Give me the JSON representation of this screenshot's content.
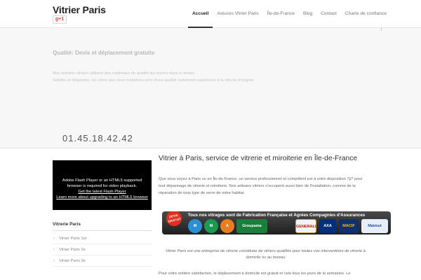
{
  "header": {
    "site_title": "Vitrier Paris",
    "gplus_label": "g+1",
    "nav": [
      "Accueil",
      "Astuces Vitrier Paris",
      "Île-de-France",
      "Blog",
      "Contact",
      "Charte de confiance"
    ]
  },
  "hero": {
    "title": "Qualité: Devis et déplacement gratuits",
    "line1": "Nos artisans vitriers utilisent des matériaux de qualité qui durent dans le temps.",
    "line2": "Solides et élégantes, les vitres que nous installons sont d'une qualité nettement supérieure à la vitrerie d'origine.",
    "phone": "01.45.18.42.42"
  },
  "sidebar": {
    "flash_line1": "Adobe Flash Player or an HTML5 supported",
    "flash_line2": "browser is required for video playback.",
    "flash_link1": "Get the latest Flash Player",
    "flash_link2": "Learn more about upgrading to an HTML5 browser",
    "section_title": "Vitrerie Paris",
    "items": [
      "Vitrier Paris 1er",
      "Vitrier Paris 2e",
      "Vitrier Paris 3e"
    ]
  },
  "main": {
    "title": "Vitrier à Paris, service de vitrerie et miroiterie en Île-de-France",
    "p1": "Que vous soyez à Paris ou en Île-de-France, un service professionnel et compétent est à votre disposition 7j/7 pour tout dépannage de vitrerie et miroiterie. Nos artisans vitriers s'occupent aussi bien de l'installation, comme de la réparation de tous type de verre de votre habitat.",
    "banner_head": "Tous nos vitrages sont de Fabrication Française et Agrées  Compagnies  d'Assurances",
    "badge": "DEVIS GRATUIT",
    "logos": [
      "M",
      "M",
      "A",
      "Groupama",
      "GENERALI",
      "AXA",
      "MACIF",
      "Matmut"
    ],
    "caption": "Vitrier Paris est une entreprise de vitrerie constituée de vitriers qualifiés pour toutes vos interventions de vitrerie à domicile ou au bureau",
    "p2": "Pour votre entière satisfaction, le déplacement à domicile est gratuit et cela tous les jours de la semaines. Le"
  }
}
